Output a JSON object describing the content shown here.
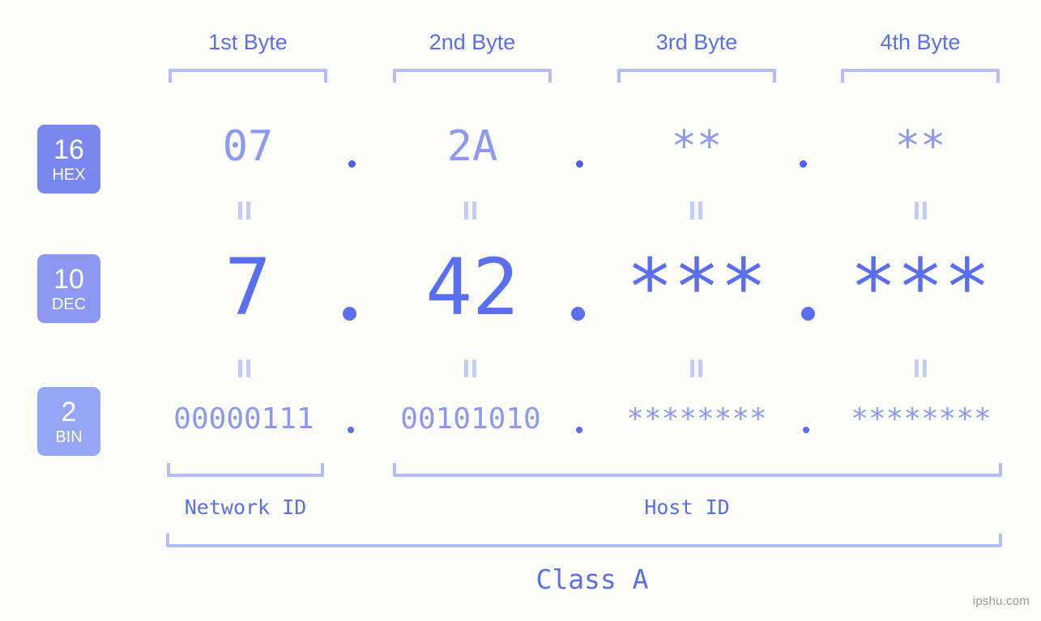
{
  "watermark": "ipshu.com",
  "header": {
    "byte_labels": [
      "1st Byte",
      "2nd Byte",
      "3rd Byte",
      "4th Byte"
    ]
  },
  "bases": [
    {
      "number": "16",
      "name": "HEX",
      "color": "#7a87ee"
    },
    {
      "number": "10",
      "name": "DEC",
      "color": "#8d98f2"
    },
    {
      "number": "2",
      "name": "BIN",
      "color": "#97a5f5"
    }
  ],
  "rows": {
    "hex": {
      "values": [
        "07",
        "2A",
        "**",
        "**"
      ],
      "separator": "."
    },
    "dec": {
      "values": [
        "7",
        "42",
        "***",
        "***"
      ],
      "separator": "."
    },
    "bin": {
      "values": [
        "00000111",
        "00101010",
        "********",
        "********"
      ],
      "separator": "."
    }
  },
  "footer": {
    "network_id": "Network ID",
    "host_id": "Host ID",
    "class": "Class A"
  },
  "colors": {
    "background": "#fdfdfa",
    "accent_strong": "#5a6ef0",
    "accent_mid": "#8d98f2",
    "accent_light": "#b3bdf7"
  }
}
